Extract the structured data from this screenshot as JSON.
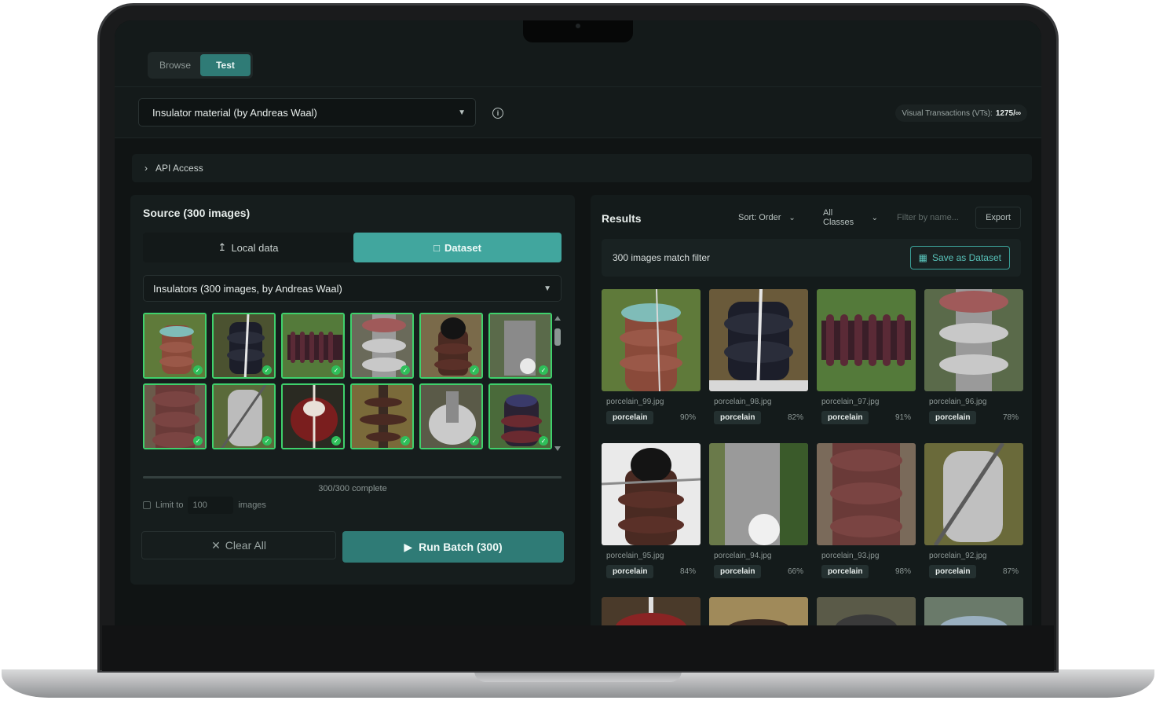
{
  "tabs": [
    {
      "label": "Browse"
    },
    {
      "label": "Test"
    }
  ],
  "model_select": {
    "value": "Insulator material (by Andreas Waal)"
  },
  "visual_transactions": {
    "label": "Visual Transactions (VTs):",
    "value": "1275/∞"
  },
  "api_access": {
    "label": "API Access"
  },
  "source": {
    "title": "Source (300 images)",
    "local_label": "Local data",
    "dataset_label": "Dataset",
    "dataset_select": "Insulators (300 images, by Andreas Waal)",
    "progress_text": "300/300 complete",
    "progress_fraction": 1.0,
    "limit_label": "Limit to",
    "limit_value": "100",
    "limit_suffix": "images",
    "clear_label": "Clear All",
    "run_label": "Run Batch (300)"
  },
  "results": {
    "title": "Results",
    "sort_label": "Sort: Order",
    "class_label": "All Classes",
    "filter_placeholder": "Filter by name...",
    "export_label": "Export",
    "match_text": "300 images match filter",
    "save_label": "Save as Dataset",
    "cards": [
      {
        "name": "porcelain_99.jpg",
        "tag": "porcelain",
        "conf": "90%"
      },
      {
        "name": "porcelain_98.jpg",
        "tag": "porcelain",
        "conf": "82%"
      },
      {
        "name": "porcelain_97.jpg",
        "tag": "porcelain",
        "conf": "91%"
      },
      {
        "name": "porcelain_96.jpg",
        "tag": "porcelain",
        "conf": "78%"
      },
      {
        "name": "porcelain_95.jpg",
        "tag": "porcelain",
        "conf": "84%"
      },
      {
        "name": "porcelain_94.jpg",
        "tag": "porcelain",
        "conf": "66%"
      },
      {
        "name": "porcelain_93.jpg",
        "tag": "porcelain",
        "conf": "98%"
      },
      {
        "name": "porcelain_92.jpg",
        "tag": "porcelain",
        "conf": "87%"
      }
    ]
  },
  "colors": {
    "accent": "#2f7b76",
    "accent_light": "#41a69e",
    "check": "#3fd16c"
  }
}
